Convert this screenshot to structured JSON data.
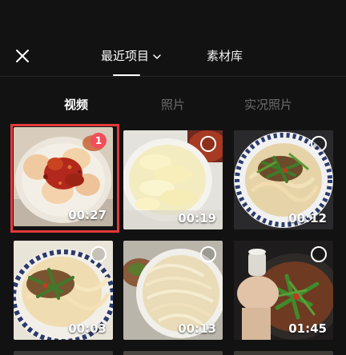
{
  "header": {
    "tab_recent": "最近项目",
    "tab_library": "素材库"
  },
  "subtabs": {
    "video": "视频",
    "photo": "照片",
    "live_photo": "实况照片"
  },
  "colors": {
    "background": "#121212",
    "selection_red": "#e4393c",
    "badge_red": "#f24d5a",
    "inactive_text": "#6b6b6b"
  },
  "videos": [
    {
      "duration": "00:27",
      "selected": true,
      "selection_index": "1"
    },
    {
      "duration": "00:19",
      "selected": false
    },
    {
      "duration": "00:12",
      "selected": false
    },
    {
      "duration": "00:03",
      "selected": false
    },
    {
      "duration": "00:13",
      "selected": false
    },
    {
      "duration": "01:45",
      "selected": false
    }
  ]
}
